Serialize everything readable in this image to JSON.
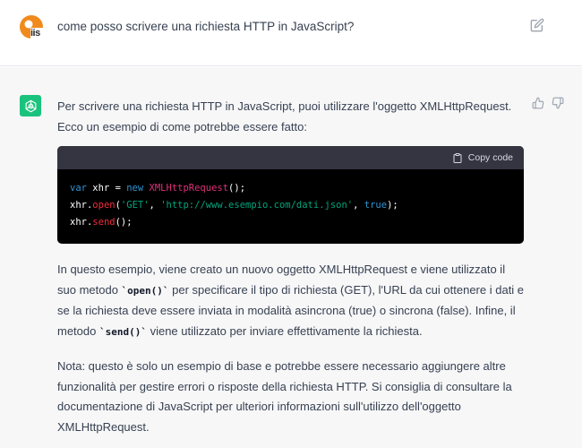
{
  "user_message": {
    "text": "come posso scrivere una richiesta HTTP in JavaScript?",
    "avatar_label": "iis"
  },
  "assistant_message": {
    "intro": "Per scrivere una richiesta HTTP in JavaScript, puoi utilizzare l'oggetto XMLHttpRequest. Ecco un esempio di come potrebbe essere fatto:",
    "code_block": {
      "copy_label": "Copy code",
      "lines": [
        [
          {
            "t": "var",
            "c": "kw"
          },
          {
            "t": " xhr = ",
            "c": ""
          },
          {
            "t": "new",
            "c": "kw"
          },
          {
            "t": " ",
            "c": ""
          },
          {
            "t": "XMLHttpRequest",
            "c": "cls"
          },
          {
            "t": "();",
            "c": ""
          }
        ],
        [
          {
            "t": "xhr.",
            "c": ""
          },
          {
            "t": "open",
            "c": "fn"
          },
          {
            "t": "(",
            "c": ""
          },
          {
            "t": "'GET'",
            "c": "str"
          },
          {
            "t": ", ",
            "c": ""
          },
          {
            "t": "'http://www.esempio.com/dati.json'",
            "c": "str"
          },
          {
            "t": ", ",
            "c": ""
          },
          {
            "t": "true",
            "c": "kw"
          },
          {
            "t": ");",
            "c": ""
          }
        ],
        [
          {
            "t": "xhr.",
            "c": ""
          },
          {
            "t": "send",
            "c": "fn"
          },
          {
            "t": "();",
            "c": ""
          }
        ]
      ]
    },
    "para2": [
      {
        "t": "In questo esempio, viene creato un nuovo oggetto XMLHttpRequest e viene utilizzato il suo metodo ",
        "code": false
      },
      {
        "t": "`open()`",
        "code": true
      },
      {
        "t": " per specificare il tipo di richiesta (GET), l'URL da cui ottenere i dati e se la richiesta deve essere inviata in modalità asincrona (true) o sincrona (false). Infine, il metodo ",
        "code": false
      },
      {
        "t": "`send()`",
        "code": true
      },
      {
        "t": " viene utilizzato per inviare effettivamente la richiesta.",
        "code": false
      }
    ],
    "para3": "Nota: questo è solo un esempio di base e potrebbe essere necessario aggiungere altre funzionalità per gestire errori o risposte della richiesta HTTP. Si consiglia di consultare la documentazione di JavaScript per ulteriori informazioni sull'utilizzo dell'oggetto XMLHttpRequest."
  },
  "icons": {
    "user_avatar": "iis-logo-icon",
    "assistant_avatar": "openai-logo-icon",
    "edit": "edit-icon",
    "thumbs_up": "thumbs-up-icon",
    "thumbs_down": "thumbs-down-icon",
    "copy": "clipboard-icon"
  },
  "colors": {
    "assistant_bg": "#f7f7f8",
    "gpt_green": "#19c37d",
    "avatar_orange": "#f08a1c",
    "code_bg": "#000000",
    "code_header_bg": "#343541"
  }
}
